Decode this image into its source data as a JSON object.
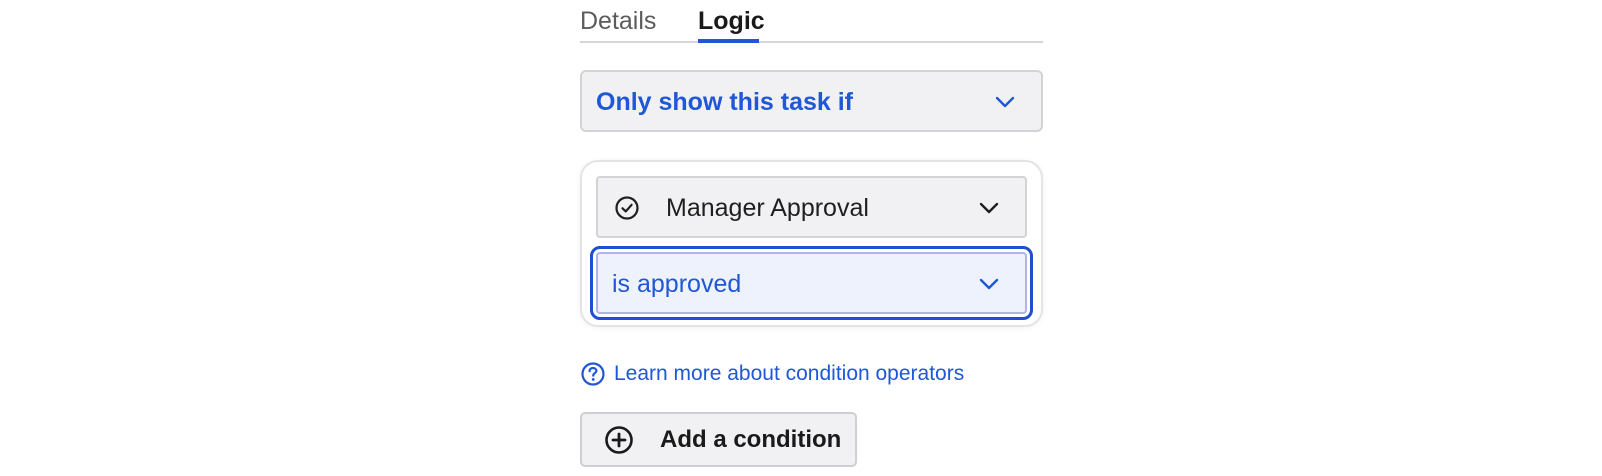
{
  "tabs": {
    "details_label": "Details",
    "logic_label": "Logic",
    "active": "Logic"
  },
  "visibility_mode": {
    "selected": "Only show this task if"
  },
  "condition": {
    "field": {
      "icon": "check-circle-icon",
      "selected": "Manager Approval"
    },
    "operator": {
      "selected": "is approved",
      "focused": true
    }
  },
  "help_link": {
    "icon": "question-circle-icon",
    "label": "Learn more about condition operators"
  },
  "add_condition": {
    "icon": "plus-circle-icon",
    "label": "Add a condition"
  },
  "colors": {
    "accent": "#1f57d6",
    "focus_ring": "#1f4fd0",
    "field_bg": "#f1f1f3",
    "selected_bg": "#eef2fc"
  }
}
